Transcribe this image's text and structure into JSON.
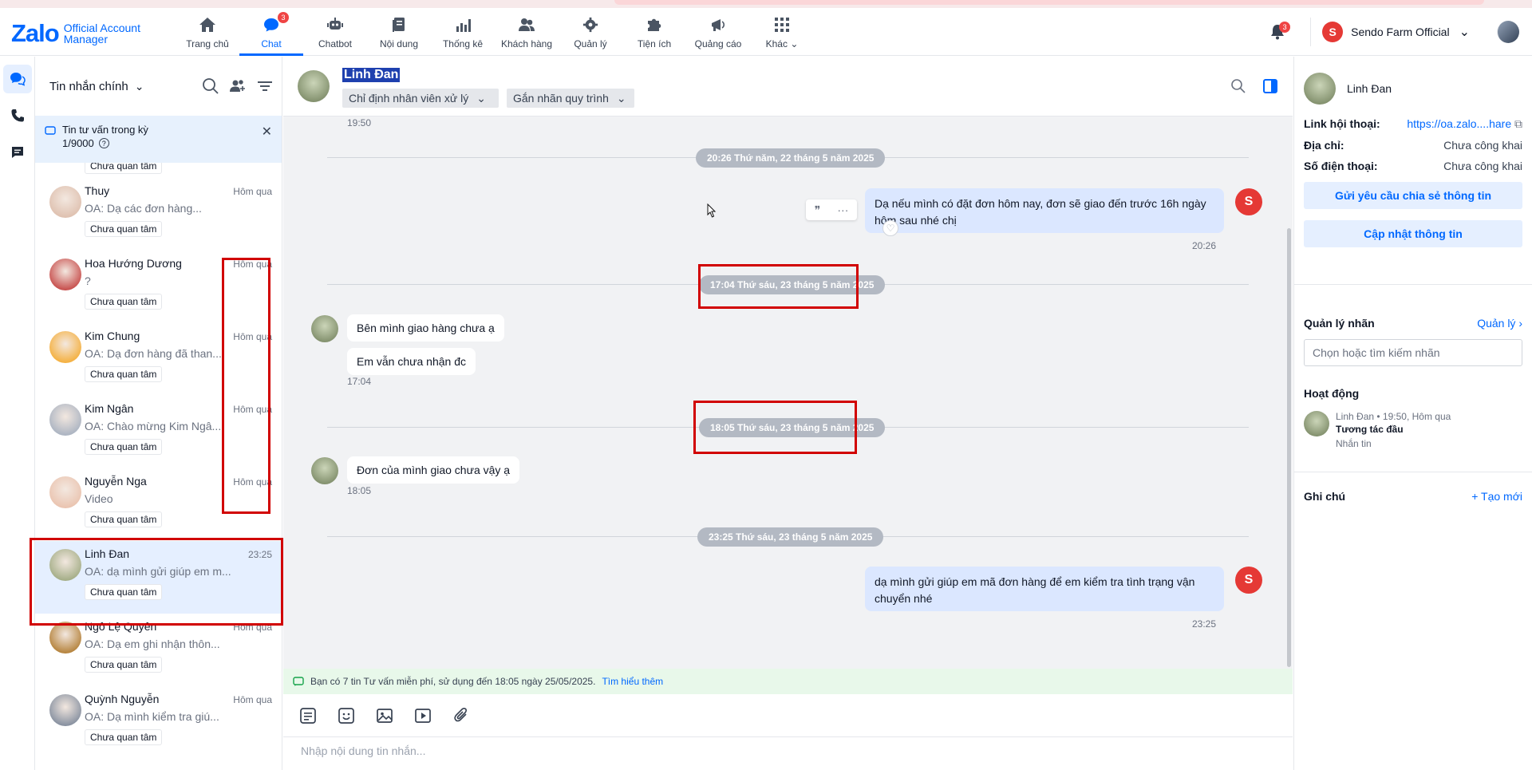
{
  "header": {
    "logo_main": "Zalo",
    "logo_sub_1": "Official Account",
    "logo_sub_2": "Manager",
    "nav": [
      {
        "label": "Trang chủ",
        "icon": "home-icon"
      },
      {
        "label": "Chat",
        "icon": "chat-icon",
        "badge": "3"
      },
      {
        "label": "Chatbot",
        "icon": "robot-icon"
      },
      {
        "label": "Nội dung",
        "icon": "document-icon"
      },
      {
        "label": "Thống kê",
        "icon": "bar-chart-icon"
      },
      {
        "label": "Khách hàng",
        "icon": "users-icon"
      },
      {
        "label": "Quản lý",
        "icon": "gear-icon"
      },
      {
        "label": "Tiện ích",
        "icon": "puzzle-icon"
      },
      {
        "label": "Quảng cáo",
        "icon": "megaphone-icon"
      },
      {
        "label": "Khác",
        "icon": "grid-icon"
      }
    ],
    "bell_badge": "3",
    "shop_name": "Sendo Farm Official"
  },
  "convlist": {
    "title": "Tin nhắn chính",
    "notice_title": "Tin tư vấn trong kỳ",
    "notice_count": "1/9000",
    "top_chip": "Chưa quan tâm",
    "items": [
      {
        "name": "Thuy",
        "time": "Hôm qua",
        "preview": "OA: Dạ các đơn hàng...",
        "chip": "Chưa quan tâm",
        "color": "#d8b4a0"
      },
      {
        "name": "Hoa Hướng Dương",
        "time": "Hôm qua",
        "preview": "?",
        "chip": "Chưa quan tâm",
        "color": "#b91c1c"
      },
      {
        "name": "Kim Chung",
        "time": "Hôm qua",
        "preview": "OA: Dạ đơn hàng đã than...",
        "chip": "Chưa quan tâm",
        "color": "#f59e0b"
      },
      {
        "name": "Kim Ngân",
        "time": "Hôm qua",
        "preview": "OA: Chào mừng Kim Ngâ...",
        "chip": "Chưa quan tâm",
        "color": "#94a3b8"
      },
      {
        "name": "Nguyễn Nga",
        "time": "Hôm qua",
        "preview": "Video",
        "chip": "Chưa quan tâm",
        "color": "#e7b8a0"
      },
      {
        "name": "Linh Đan",
        "time": "23:25",
        "preview": "OA: dạ mình gửi giúp em m...",
        "chip": "Chưa quan tâm",
        "color": "#8a9a6a"
      },
      {
        "name": "Ngô Lệ Quyên",
        "time": "Hôm qua",
        "preview": "OA: Dạ em ghi nhận thôn...",
        "chip": "Chưa quan tâm",
        "color": "#a16207"
      },
      {
        "name": "Quỳnh Nguyễn",
        "time": "Hôm qua",
        "preview": "OA: Dạ mình kiểm tra giú...",
        "chip": "Chưa quan tâm",
        "color": "#64748b"
      }
    ]
  },
  "chat": {
    "name": "Linh Đan",
    "assign_label": "Chỉ định nhân viên xử lý",
    "tag_label": "Gắn nhãn quy trình",
    "top_time": "19:50",
    "date1": "20:26 Thứ năm, 22 tháng 5 năm 2025",
    "out1": "Dạ nếu mình có đặt đơn hôm nay, đơn sẽ giao đến trước 16h ngày hôm sau nhé chị",
    "out1_time": "20:26",
    "date2": "17:04 Thứ sáu, 23 tháng 5 năm 2025",
    "in1": "Bên mình giao hàng chưa ạ",
    "in2": "Em vẫn chưa nhận đc",
    "in_time1": "17:04",
    "date3": "18:05 Thứ sáu, 23 tháng 5 năm 2025",
    "in3": "Đơn của mình giao chưa vậy ạ",
    "in_time2": "18:05",
    "date4": "23:25 Thứ sáu, 23 tháng 5 năm 2025",
    "out2": "dạ mình gửi giúp em mã đơn hàng để em kiểm tra tình trạng vận chuyển nhé",
    "out2_time": "23:25",
    "info_text": "Bạn có 7 tin Tư vấn miễn phí, sử dụng đến 18:05 ngày 25/05/2025.",
    "info_link": "Tìm hiểu thêm",
    "composer_placeholder": "Nhập nội dung tin nhắn..."
  },
  "panel": {
    "name": "Linh Đan",
    "link_label": "Link hội thoại:",
    "link_value": "https://oa.zalo....hare",
    "addr_label": "Địa chỉ:",
    "addr_value": "Chưa công khai",
    "phone_label": "Số điện thoại:",
    "phone_value": "Chưa công khai",
    "btn_share": "Gửi yêu cầu chia sẻ thông tin",
    "btn_update": "Cập nhật thông tin",
    "tags_title": "Quản lý nhãn",
    "tags_manage": "Quản lý",
    "tags_placeholder": "Chọn hoặc tìm kiếm nhãn",
    "activity_title": "Hoạt động",
    "activity_who": "Linh Đan",
    "activity_time": "19:50, Hôm qua",
    "activity_main": "Tương tác đầu",
    "activity_sub": "Nhắn tin",
    "notes_title": "Ghi chú",
    "notes_new": "+ Tạo mới"
  }
}
